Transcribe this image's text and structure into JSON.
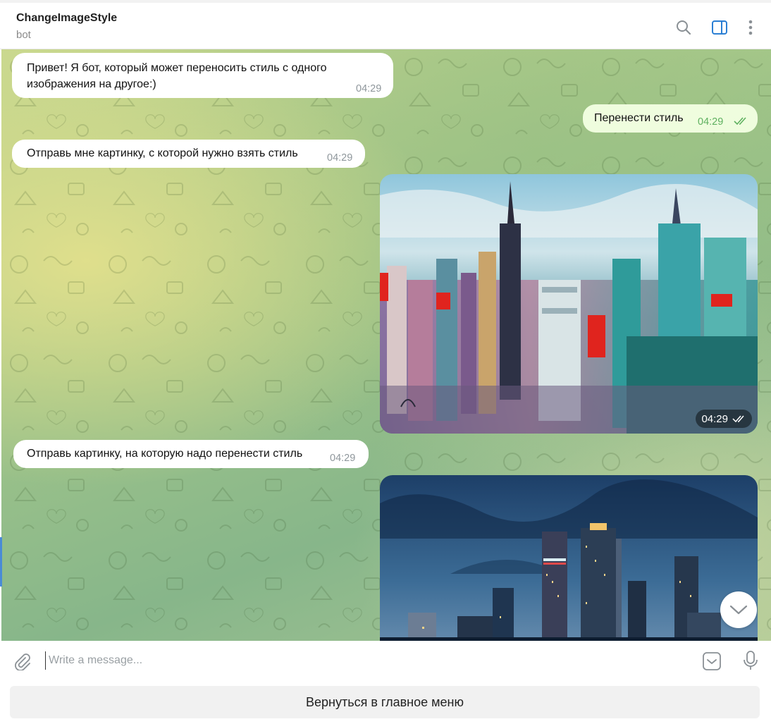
{
  "header": {
    "title": "ChangeImageStyle",
    "subtitle": "bot",
    "icons": [
      "search-icon",
      "sidebar-toggle-icon",
      "more-vertical-icon"
    ],
    "accent_color": "#2b7fd4"
  },
  "messages": [
    {
      "id": "m1",
      "direction": "incoming",
      "text_line1": "Привет! Я бот, который может переносить стиль с одного",
      "text_line2": "изображения на другое:)",
      "time": "04:29"
    },
    {
      "id": "m2",
      "direction": "outgoing",
      "text": "Перенести стиль",
      "time": "04:29",
      "status": "read"
    },
    {
      "id": "m3",
      "direction": "incoming",
      "text": "Отправь мне картинку, с которой нужно взять стиль",
      "time": "04:29"
    },
    {
      "id": "m4",
      "direction": "outgoing",
      "type": "photo",
      "content": "abstract-painted-city-skyline",
      "time": "04:29",
      "status": "read"
    },
    {
      "id": "m5",
      "direction": "incoming",
      "text": "Отправь картинку, на которую надо перенести стиль",
      "time": "04:29"
    },
    {
      "id": "m6",
      "direction": "outgoing",
      "type": "photo",
      "content": "night-city-skyscrapers"
    }
  ],
  "composer": {
    "placeholder": "Write a message...",
    "value": "",
    "icons": [
      "attach-icon",
      "bot-keyboard-icon",
      "microphone-icon"
    ]
  },
  "keyboard": {
    "button_label": "Вернуться в главное меню"
  },
  "colors": {
    "incoming_bubble": "#ffffff",
    "outgoing_bubble": "#effdde",
    "outgoing_time": "#5fb160",
    "incoming_time": "#8f979c"
  }
}
